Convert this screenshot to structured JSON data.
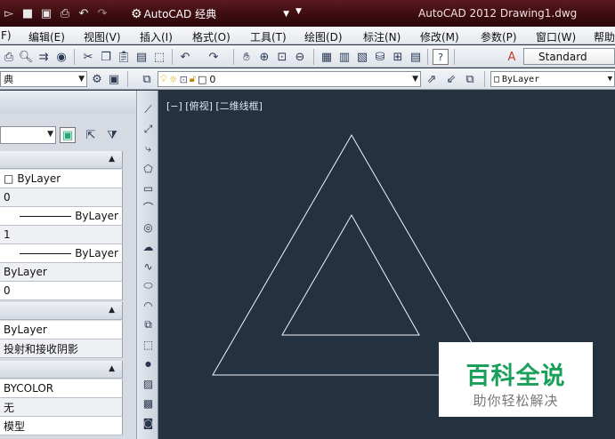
{
  "titlebar": {
    "workspace": "AutoCAD 经典",
    "title": "AutoCAD 2012    Drawing1.dwg"
  },
  "menus": [
    "F)",
    "编辑(E)",
    "视图(V)",
    "插入(I)",
    "格式(O)",
    "工具(T)",
    "绘图(D)",
    "标注(N)",
    "修改(M)",
    "参数(P)",
    "窗口(W)",
    "帮助"
  ],
  "toolbar": {
    "text_style": "Standard"
  },
  "layers_toolbar": {
    "workspace_combo": "典",
    "layer_combo": "0",
    "color_combo": "ByLayer"
  },
  "palette": {
    "general": {
      "color": "ByLayer",
      "layer": "0",
      "linetype": "ByLayer",
      "linetype_scale": "1",
      "lineweight": "ByLayer",
      "transparency": "ByLayer",
      "thickness": "0"
    },
    "material": {
      "material": "ByLayer",
      "shadow": "投射和接收阴影"
    },
    "plot": {
      "plot_style": "BYCOLOR",
      "plot_style_table": "无",
      "space": "模型"
    }
  },
  "viewport": {
    "label": "[−] [俯视] [二维线框]"
  },
  "watermark": {
    "brand": "百科全说",
    "tagline": "助你轻松解决"
  },
  "colors": {
    "canvas": "#243140",
    "title_bar": "#3a0c10",
    "watermark_green": "#1aa05a"
  }
}
